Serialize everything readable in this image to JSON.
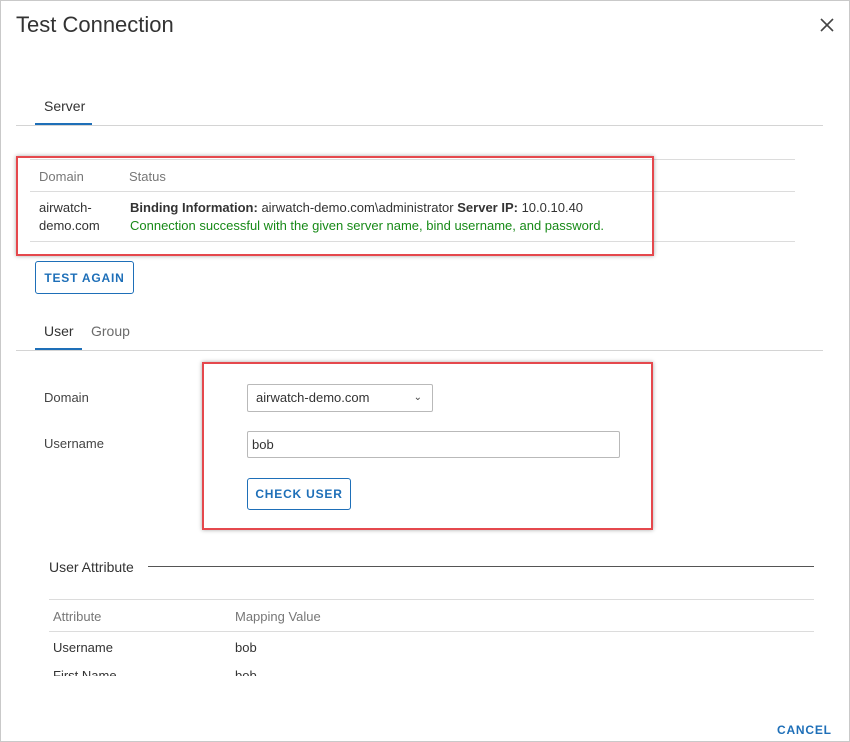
{
  "dialog": {
    "title": "Test Connection"
  },
  "server_tabs": [
    {
      "label": "Server",
      "active": true
    }
  ],
  "server_table": {
    "headers": {
      "domain": "Domain",
      "status": "Status"
    },
    "row": {
      "domain_line1": "airwatch-",
      "domain_line2": "demo.com",
      "binding_label": "Binding Information:",
      "binding_value": "airwatch-demo.com\\administrator",
      "server_ip_label": "Server IP:",
      "server_ip_value": "10.0.10.40",
      "message": "Connection successful with the given server name, bind username, and password."
    }
  },
  "test_again_label": "TEST AGAIN",
  "user_tabs": [
    {
      "label": "User",
      "active": true
    },
    {
      "label": "Group",
      "active": false
    }
  ],
  "user_form": {
    "domain_label": "Domain",
    "domain_value": "airwatch-demo.com",
    "username_label": "Username",
    "username_value": "bob",
    "check_user_label": "CHECK USER"
  },
  "user_attribute": {
    "title": "User Attribute",
    "headers": {
      "attribute": "Attribute",
      "mapping": "Mapping Value"
    },
    "rows": [
      {
        "attribute": "Username",
        "value": "bob"
      },
      {
        "attribute": "First Name",
        "value": "bob"
      }
    ]
  },
  "footer": {
    "cancel_label": "CANCEL"
  },
  "colors": {
    "accent": "#1e6fb8",
    "success": "#178a17",
    "highlight": "#e5484d"
  }
}
